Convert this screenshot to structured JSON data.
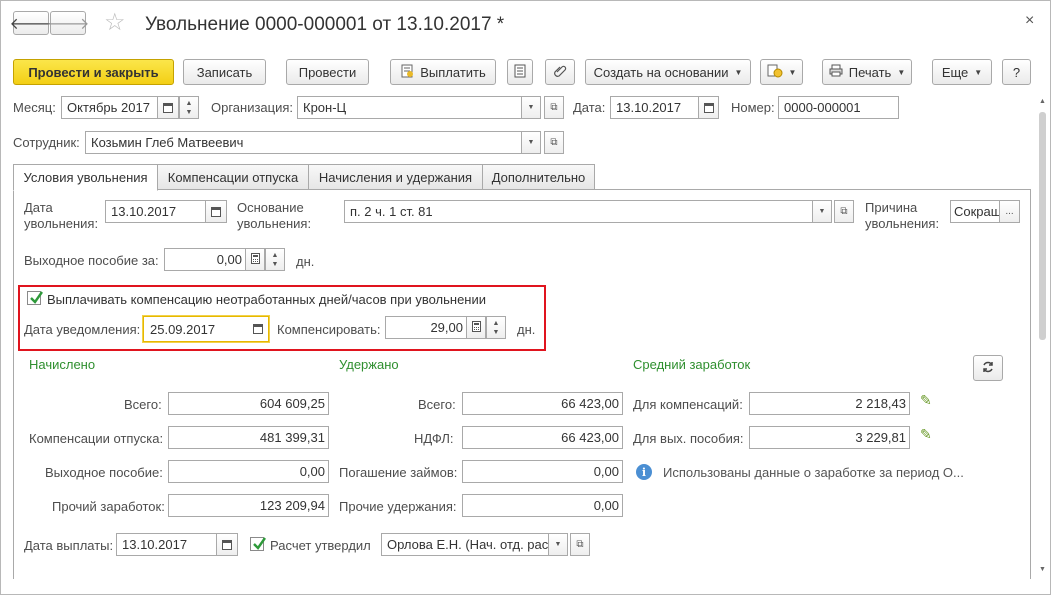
{
  "header": {
    "back": "🡐",
    "forward": "🡒",
    "title": "Увольнение 0000-000001 от 13.10.2017 *",
    "close": "×"
  },
  "toolbar": {
    "post_close": "Провести и закрыть",
    "save": "Записать",
    "post": "Провести",
    "pay": "Выплатить",
    "create_based": "Создать на основании",
    "print": "Печать",
    "more": "Еще",
    "help": "?"
  },
  "top": {
    "month_label": "Месяц:",
    "month_value": "Октябрь 2017",
    "org_label": "Организация:",
    "org_value": "Крон-Ц",
    "date_label": "Дата:",
    "date_value": "13.10.2017",
    "number_label": "Номер:",
    "number_value": "0000-000001",
    "employee_label": "Сотрудник:",
    "employee_value": "Козьмин Глеб Матвеевич"
  },
  "tabs": [
    "Условия увольнения",
    "Компенсации отпуска",
    "Начисления и удержания",
    "Дополнительно"
  ],
  "conditions": {
    "dismissal_date_label1": "Дата",
    "dismissal_date_label2": "увольнения:",
    "dismissal_date_value": "13.10.2017",
    "basis_label1": "Основание",
    "basis_label2": "увольнения:",
    "basis_value": "п. 2 ч. 1 ст. 81",
    "reason_label1": "Причина",
    "reason_label2": "увольнения:",
    "reason_value": "Сокращ",
    "reason_btn": "...",
    "severance_label": "Выходное пособие за:",
    "severance_value": "0,00",
    "severance_unit": "дн.",
    "compensation_check_label": "Выплачивать компенсацию неотработанных дней/часов при увольнении",
    "notice_date_label": "Дата уведомления:",
    "notice_date_value": "25.09.2017",
    "compensate_label": "Компенсировать:",
    "compensate_value": "29,00",
    "compensate_unit": "дн."
  },
  "accrued": {
    "title": "Начислено",
    "total_label": "Всего:",
    "total": "604 609,25",
    "vacation_comp_label": "Компенсации отпуска:",
    "vacation_comp": "481 399,31",
    "severance_label": "Выходное пособие:",
    "severance": "0,00",
    "other_label": "Прочий заработок:",
    "other": "123 209,94"
  },
  "withheld": {
    "title": "Удержано",
    "total_label": "Всего:",
    "total": "66 423,00",
    "ndfl_label": "НДФЛ:",
    "ndfl": "66 423,00",
    "loans_label": "Погашение займов:",
    "loans": "0,00",
    "other_label": "Прочие удержания:",
    "other": "0,00"
  },
  "average": {
    "title": "Средний заработок",
    "comp_label": "Для компенсаций:",
    "comp": "2 218,43",
    "severance_label": "Для вых. пособия:",
    "severance": "3 229,81",
    "info": "Использованы данные о заработке за период О..."
  },
  "bottom": {
    "pay_date_label": "Дата выплаты:",
    "pay_date_value": "13.10.2017",
    "approved_label": "Расчет утвердил",
    "approved_value": "Орлова Е.Н. (Нач. отд. рас"
  }
}
